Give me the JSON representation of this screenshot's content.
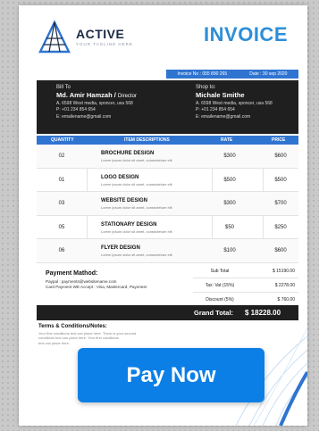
{
  "brand": {
    "name": "ACTIVE",
    "tagline": "YOUR TAGLINE HERE"
  },
  "title": "INVOICE",
  "invoice_strip": {
    "number": "Invoice No : 055 890 265",
    "date": "Date : 30 sep 2020"
  },
  "bill_to": {
    "label": "Bill To",
    "name": "Md. Amir Hamzah /",
    "role": "Director",
    "address": "A. 6598 West media, sponcer, usa 568",
    "phone": "P: +01 234 854 654",
    "email": "E: emailename@gmail.com"
  },
  "ship_to": {
    "label": "Shop to:",
    "name": "Michale Smithe",
    "address": "A. 6598 West media, sponcer, usa 568",
    "phone": "P: +01 234 854 654",
    "email": "E: emailename@gmail.com"
  },
  "table": {
    "headers": {
      "qty": "QUANTITY",
      "desc": "ITEM DESCRIPTIONS",
      "rate": "RATE",
      "price": "PRICE"
    },
    "rows": [
      {
        "qty": "02",
        "title": "BROCHURE DESIGN",
        "sub": "Lorem ipsum dolor sit amet, consectetuer elit",
        "rate": "$300",
        "price": "$600"
      },
      {
        "qty": "01",
        "title": "LOGO DESIGN",
        "sub": "Lorem ipsum dolor sit amet, consectetuer elit",
        "rate": "$500",
        "price": "$500"
      },
      {
        "qty": "03",
        "title": "WEBSITE DESIGN",
        "sub": "Lorem ipsum dolor sit amet, consectetuer elit",
        "rate": "$300",
        "price": "$700"
      },
      {
        "qty": "05",
        "title": "STATIONARY DESIGN",
        "sub": "Lorem ipsum dolor sit amet, consectetuer elit",
        "rate": "$50",
        "price": "$250"
      },
      {
        "qty": "06",
        "title": "FLYER DESIGN",
        "sub": "Lorem ipsum dolor sit amet, consectetuer elit",
        "rate": "$100",
        "price": "$600"
      }
    ]
  },
  "payment": {
    "heading": "Payment Mathod:",
    "line1": "Paypal : payments@websitename.com",
    "line2": "Card Payment WE Accept : Visa, Mastercard, Payoneer"
  },
  "totals": {
    "subtotal_label": "Sub Total",
    "subtotal_value": "$ 15190.00",
    "tax_label": "Tax: Vat (15%)",
    "tax_value": "$ 2278.00",
    "discount_label": "Discount (5%)",
    "discount_value": "$ 760.00",
    "grand_label": "Grand Total:",
    "grand_value": "$ 18228.00"
  },
  "terms": {
    "heading": "Terms & Conditions/Notes:",
    "line1": "Your first conditions text can place here. There is your second",
    "line2": "conditions text can place here. Your first conditions",
    "line3": "text can place here."
  },
  "cta": {
    "label": "Pay Now"
  },
  "colors": {
    "accent": "#2d8fd8",
    "band": "#1f1f1f",
    "strip": "#2f74d0",
    "button": "#0b7fe6"
  }
}
